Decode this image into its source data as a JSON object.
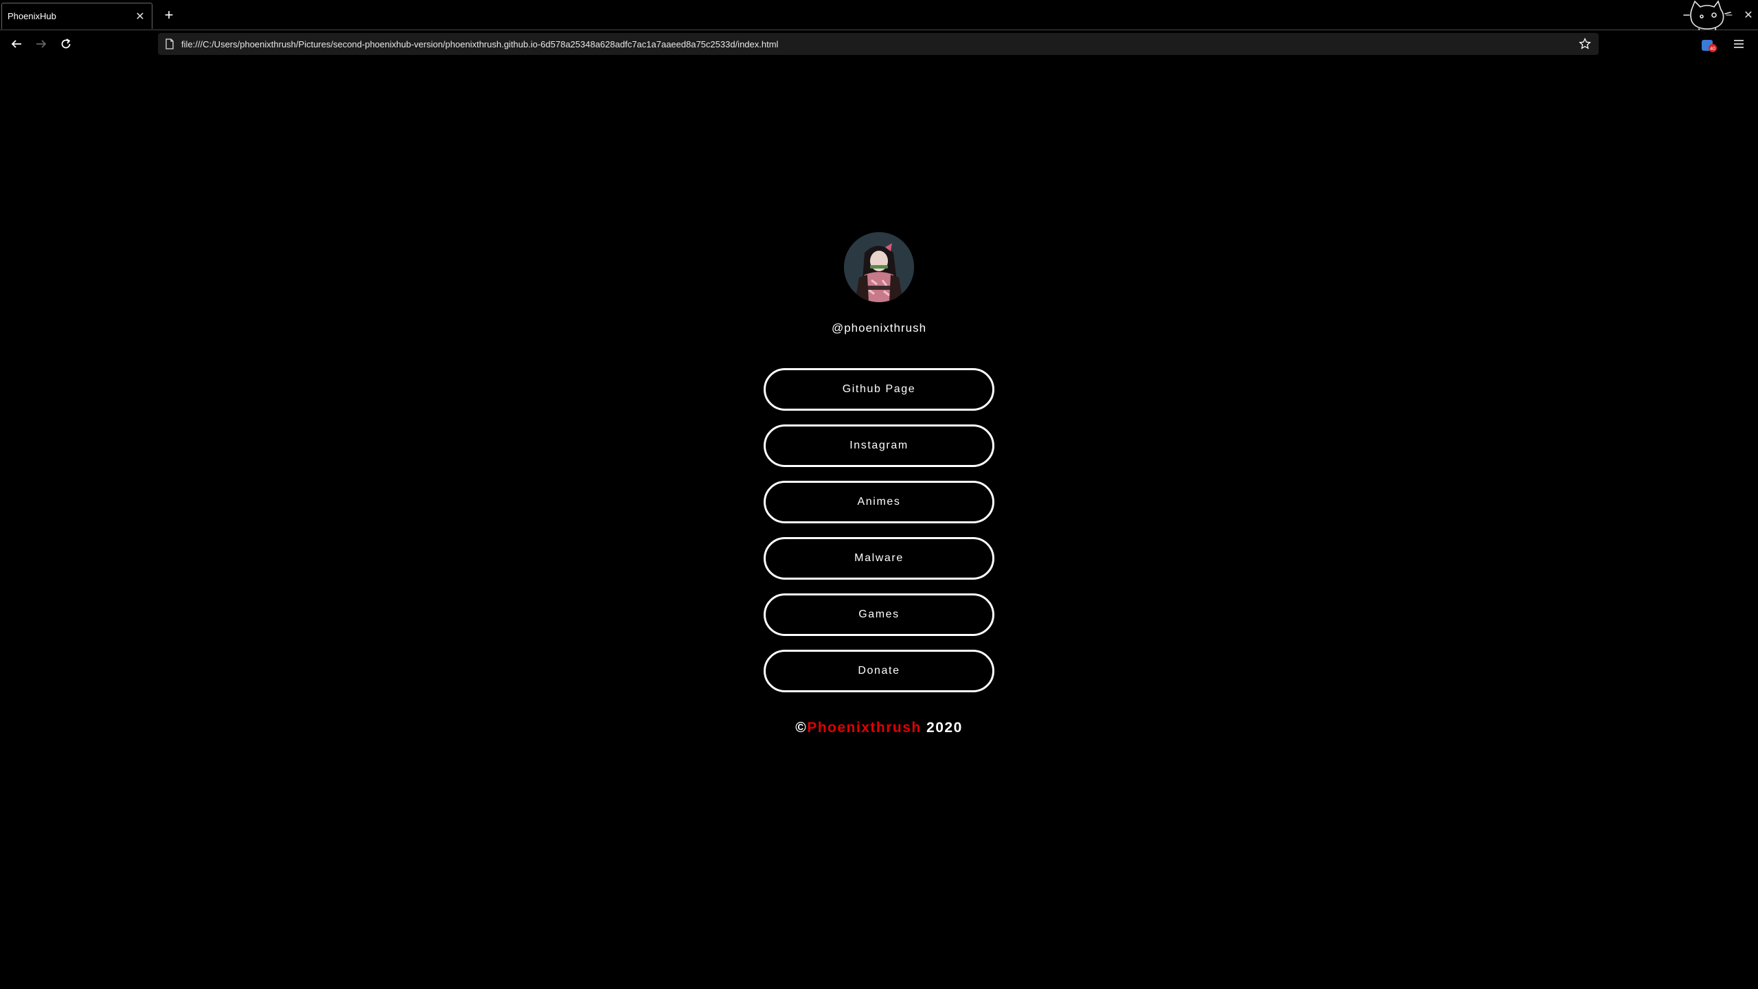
{
  "browser": {
    "tab": {
      "title": "PhoenixHub",
      "close_icon": "close-icon"
    },
    "new_tab_icon": "plus-icon",
    "url": "file:///C:/Users/phoenixthrush/Pictures/second-phoenixhub-version/phoenixthrush.github.io-6d578a25348a628adfc7ac1a7aaeed8a75c2533d/index.html",
    "extension_badge": "40",
    "window_controls": {
      "minimize_symbol": "–",
      "close_symbol": "✕"
    }
  },
  "profile": {
    "handle": "@phoenixthrush"
  },
  "links": [
    {
      "label": "Github Page"
    },
    {
      "label": "Instagram"
    },
    {
      "label": "Animes"
    },
    {
      "label": "Malware"
    },
    {
      "label": "Games"
    },
    {
      "label": "Donate"
    }
  ],
  "footer": {
    "copyright_symbol": "©",
    "name": "Phoenixthrush",
    "year": " 2020",
    "name_color": "#e00000"
  }
}
